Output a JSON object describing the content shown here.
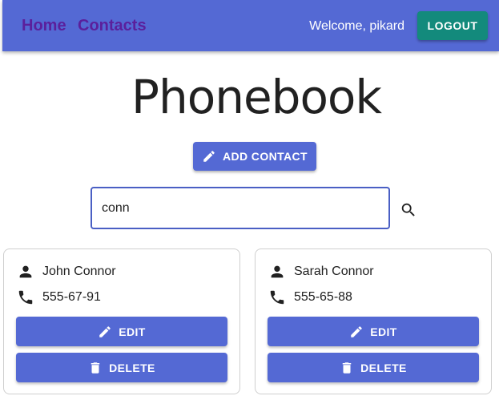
{
  "nav": {
    "home_label": "Home",
    "contacts_label": "Contacts",
    "welcome_text": "Welcome, pikard",
    "logout_label": "LOGOUT"
  },
  "page": {
    "title": "Phonebook",
    "add_label": "ADD CONTACT"
  },
  "search": {
    "value": "conn",
    "icon": "search-icon"
  },
  "contacts": [
    {
      "name": "John Connor",
      "phone": "555-67-91",
      "edit_label": "EDIT",
      "delete_label": "DELETE"
    },
    {
      "name": "Sarah Connor",
      "phone": "555-65-88",
      "edit_label": "EDIT",
      "delete_label": "DELETE"
    }
  ],
  "colors": {
    "primary": "#5469d4",
    "logout": "#138a7c",
    "nav_link": "#5b1f9c"
  }
}
